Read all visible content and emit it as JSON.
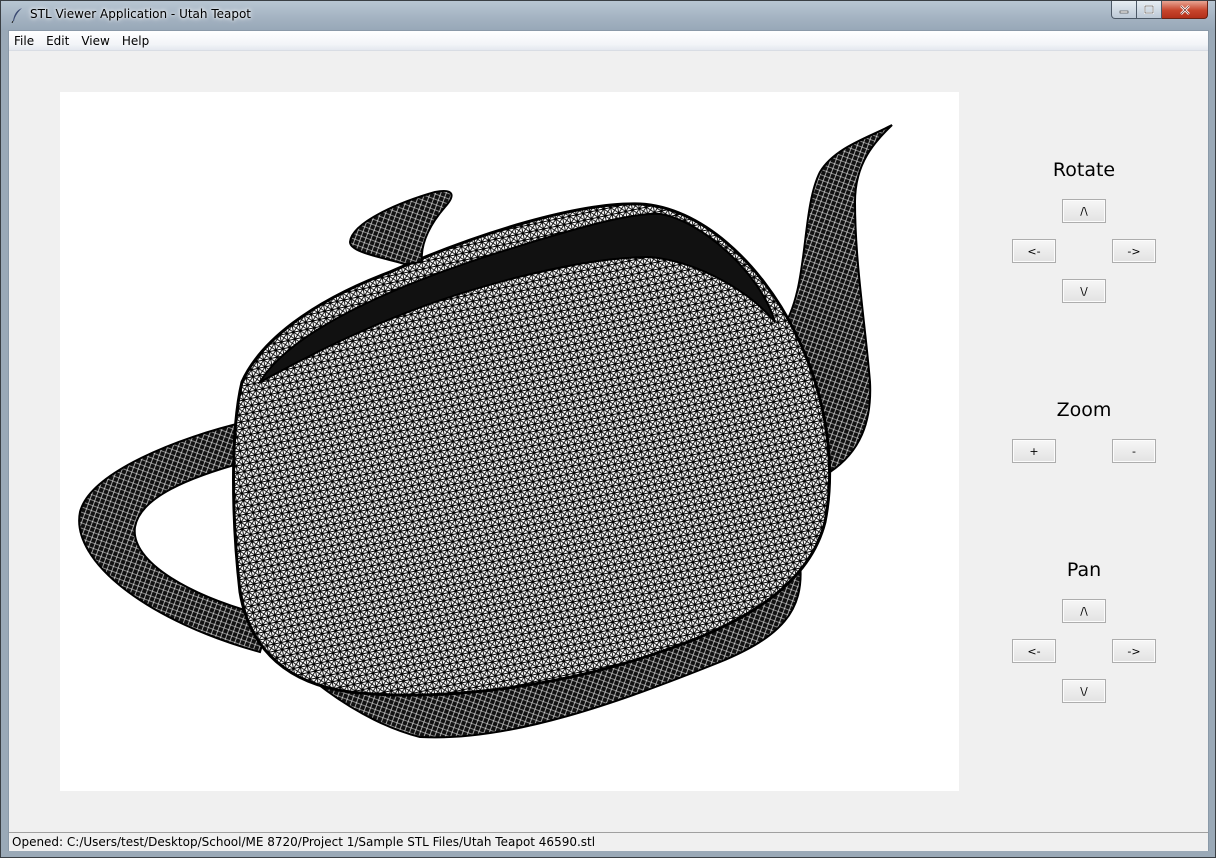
{
  "window": {
    "title": "STL Viewer Application - Utah Teapot"
  },
  "menubar": {
    "items": [
      "File",
      "Edit",
      "View",
      "Help"
    ]
  },
  "controls": {
    "rotate": {
      "title": "Rotate",
      "up": "/\\",
      "left": "<-",
      "right": "->",
      "down": "\\/"
    },
    "zoom": {
      "title": "Zoom",
      "in": "+",
      "out": "-"
    },
    "pan": {
      "title": "Pan",
      "up": "/\\",
      "left": "<-",
      "right": "->",
      "down": "\\/"
    }
  },
  "status": {
    "text": "Opened: C:/Users/test/Desktop/School/ME 8720/Project 1/Sample STL Files/Utah Teapot 46590.stl"
  },
  "colors": {
    "canvas_bg": "#ffffff",
    "wireframe": "#000000",
    "client_bg": "#f0f0f0"
  },
  "icons": {
    "app": "feather-icon",
    "minimize": "minimize-icon",
    "maximize": "maximize-icon",
    "close": "close-icon"
  }
}
